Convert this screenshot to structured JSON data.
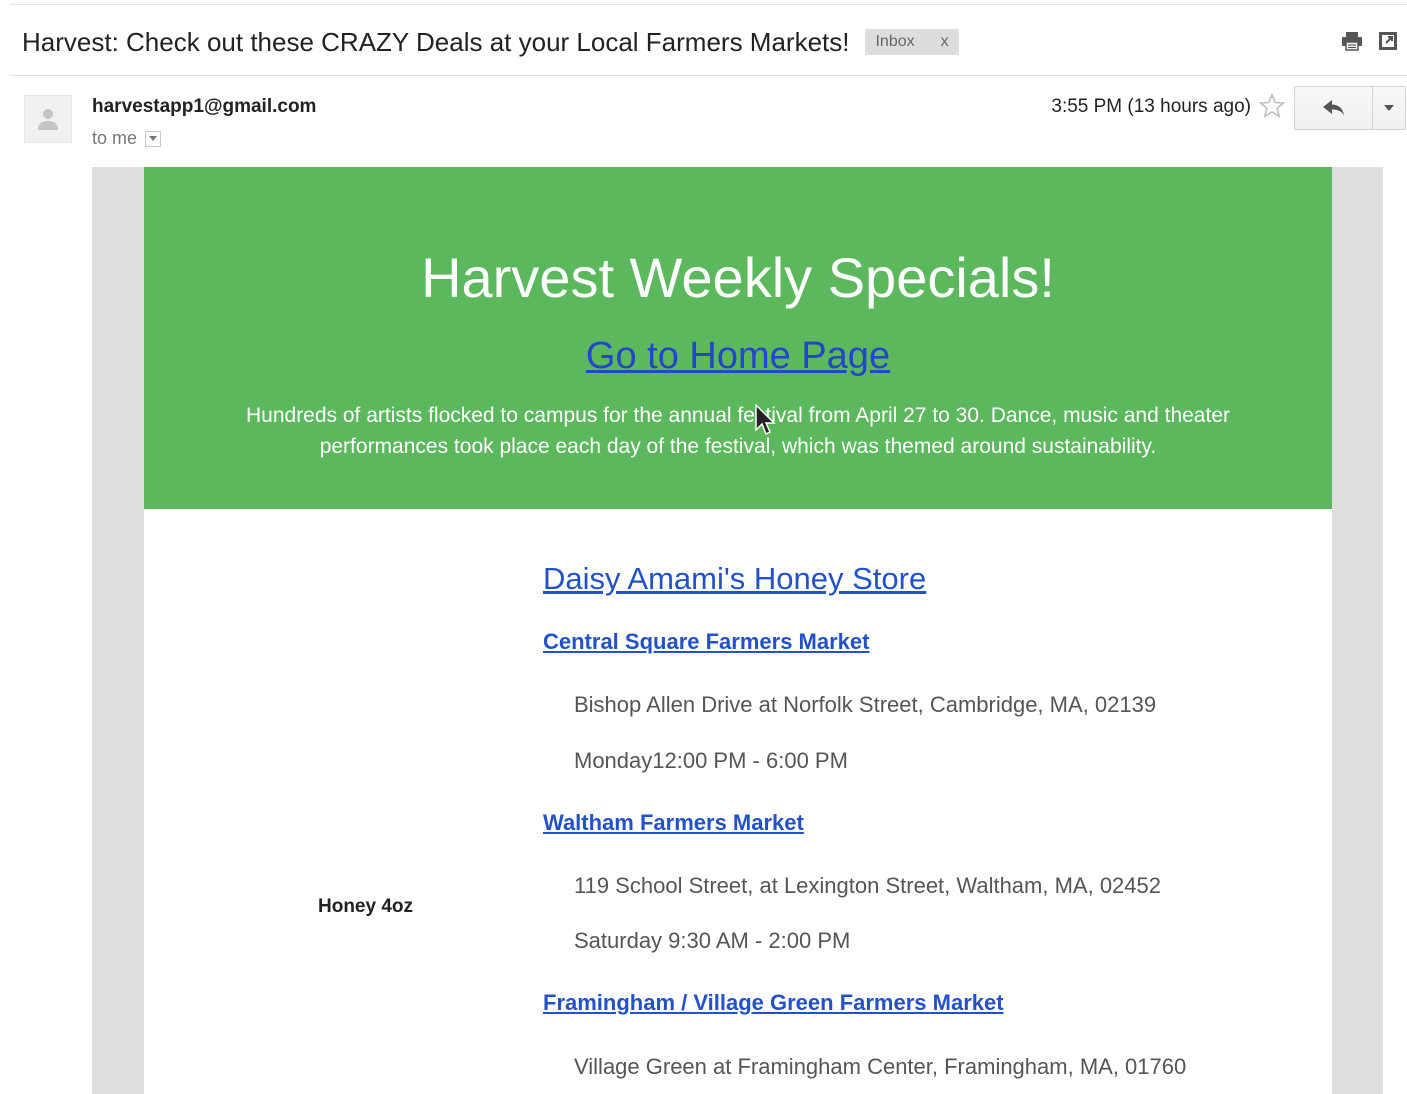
{
  "email": {
    "subject": "Harvest: Check out these CRAZY Deals at your Local Farmers Markets!",
    "label": "Inbox",
    "label_remove": "x",
    "sender": "harvestapp1@gmail.com",
    "to_line": "to me",
    "timestamp": "3:55 PM (13 hours ago)",
    "icons": {
      "print": "print-icon",
      "new_window": "new-window-icon",
      "star": "star-icon",
      "reply": "reply-icon",
      "more": "chevron-down-icon",
      "avatar": "avatar-icon",
      "cursor": "mouse-cursor-icon"
    }
  },
  "newsletter": {
    "title": "Harvest Weekly Specials!",
    "home_link": "Go to Home Page",
    "description": "Hundreds of artists flocked to campus for the annual festival from April 27 to 30. Dance, music and theater performances took place each day of the festival, which was themed around sustainability.",
    "store_name": "Daisy Amami's Honey Store",
    "product": "Honey 4oz",
    "markets": [
      {
        "name": "Central Square Farmers Market",
        "address": "Bishop Allen Drive at Norfolk Street, Cambridge, MA, 02139",
        "hours": "Monday12:00 PM - 6:00 PM"
      },
      {
        "name": "Waltham Farmers Market",
        "address": "119 School Street, at Lexington Street, Waltham, MA, 02452",
        "hours": "Saturday 9:30 AM - 2:00 PM"
      },
      {
        "name": "Framingham / Village Green Farmers Market",
        "address": "Village Green at Framingham Center, Framingham, MA, 01760"
      }
    ]
  },
  "colors": {
    "banner_green": "#5cb85c",
    "link_blue": "#2351c7",
    "canvas_gray": "#dedede"
  }
}
